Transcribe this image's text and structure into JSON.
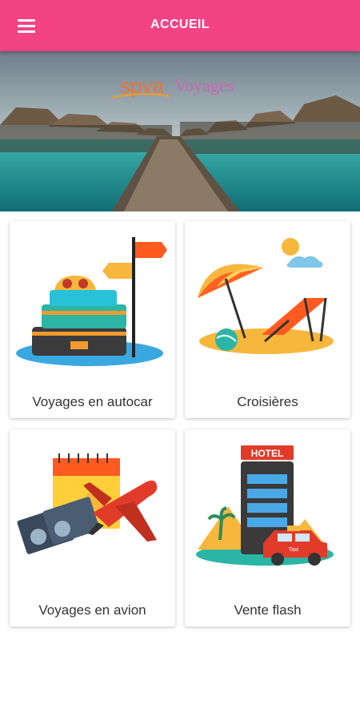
{
  "appbar": {
    "title": "ACCUEIL",
    "menu_icon": "hamburger-menu-icon"
  },
  "hero": {
    "logo_spva": "spva",
    "logo_voyages": "Voyages"
  },
  "cards": [
    {
      "label": "Voyages en autocar",
      "icon": "luggage-signpost-illustration"
    },
    {
      "label": "Croisières",
      "icon": "beach-umbrella-illustration"
    },
    {
      "label": "Voyages en avion",
      "icon": "airplane-tickets-illustration"
    },
    {
      "label": "Vente flash",
      "icon": "hotel-taxi-illustration",
      "sign_text": "HOTEL",
      "taxi_text": "Taxi"
    }
  ],
  "colors": {
    "appbar": "#f44383",
    "card_text": "#333333"
  }
}
